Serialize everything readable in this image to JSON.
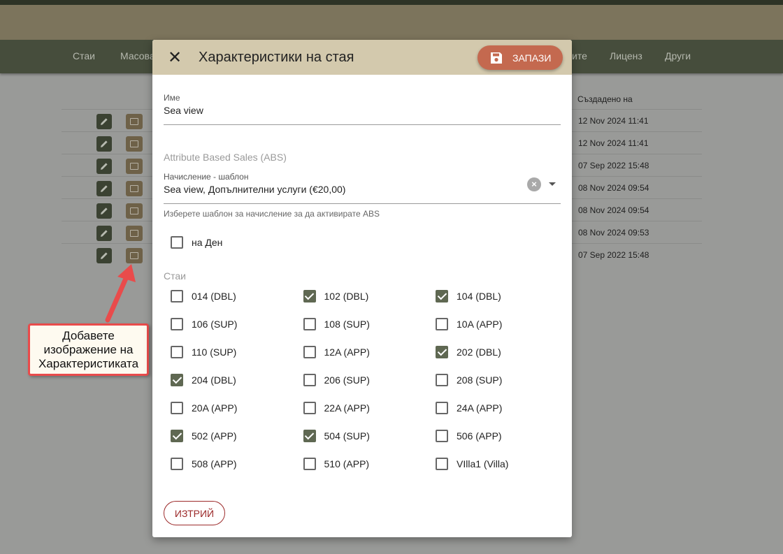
{
  "nav": {
    "items": [
      "Стаи",
      "Масова",
      "ите",
      "Лиценз",
      "Други"
    ]
  },
  "table": {
    "created_header": "Създадено на",
    "rows": [
      "12 Nov 2024 11:41",
      "12 Nov 2024 11:41",
      "07 Sep 2022 15:48",
      "08 Nov 2024 09:54",
      "08 Nov 2024 09:54",
      "08 Nov 2024 09:53",
      "07 Sep 2022 15:48"
    ]
  },
  "annotation": {
    "text": "Добавете изображение на Характеристиката"
  },
  "dialog": {
    "title": "Характеристики на стая",
    "close_icon": "close-icon",
    "save_label": "ЗАПАЗИ",
    "name_label": "Име",
    "name_value": "Sea view",
    "abs_section": "Attribute Based Sales (ABS)",
    "charge_label": "Начисление - шаблон",
    "charge_value": "Sea view, Допълнителни услуги (€20,00)",
    "charge_hint": "Изберете шаблон за начисление за да активирате ABS",
    "per_day_label": "на Ден",
    "per_day_checked": false,
    "rooms_section": "Стаи",
    "rooms": [
      {
        "label": "014 (DBL)",
        "checked": false
      },
      {
        "label": "102 (DBL)",
        "checked": true
      },
      {
        "label": "104 (DBL)",
        "checked": true
      },
      {
        "label": "106 (SUP)",
        "checked": false
      },
      {
        "label": "108 (SUP)",
        "checked": false
      },
      {
        "label": "10A (APP)",
        "checked": false
      },
      {
        "label": "110 (SUP)",
        "checked": false
      },
      {
        "label": "12A (APP)",
        "checked": false
      },
      {
        "label": "202 (DBL)",
        "checked": true
      },
      {
        "label": "204 (DBL)",
        "checked": true
      },
      {
        "label": "206 (SUP)",
        "checked": false
      },
      {
        "label": "208 (SUP)",
        "checked": false
      },
      {
        "label": "20A (APP)",
        "checked": false
      },
      {
        "label": "22A (APP)",
        "checked": false
      },
      {
        "label": "24A (APP)",
        "checked": false
      },
      {
        "label": "502 (APP)",
        "checked": true
      },
      {
        "label": "504 (SUP)",
        "checked": true
      },
      {
        "label": "506 (APP)",
        "checked": false
      },
      {
        "label": "508 (APP)",
        "checked": false
      },
      {
        "label": "510 (APP)",
        "checked": false
      },
      {
        "label": "VIlla1 (Villa)",
        "checked": false
      }
    ],
    "delete_label": "ИЗТРИЙ"
  },
  "colors": {
    "header_bg": "#d3c9ad",
    "save_button": "#c4694f",
    "checkbox_checked": "#5f6852",
    "delete_border": "#9c2a2a",
    "navbar": "#464d3c",
    "callout_border": "#e94b4b"
  }
}
